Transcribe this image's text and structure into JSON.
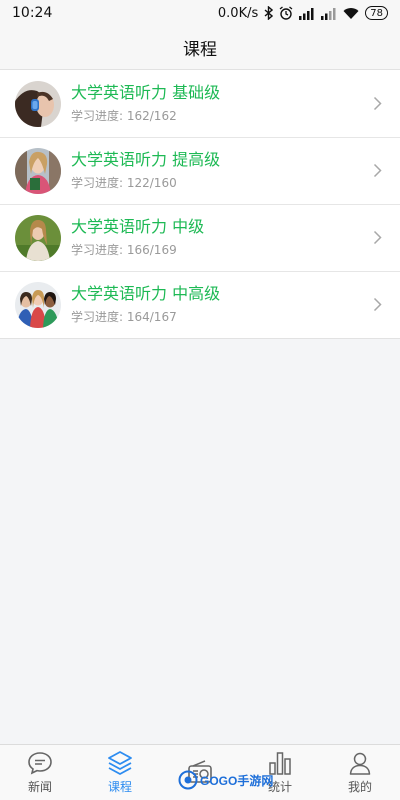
{
  "status_bar": {
    "time": "10:24",
    "network_speed": "0.0K/s",
    "battery": "78",
    "icons": [
      "bluetooth-icon",
      "alarm-icon",
      "signal-icon",
      "signal-icon",
      "wifi-icon",
      "battery-icon"
    ]
  },
  "header": {
    "title": "课程"
  },
  "courses": [
    {
      "title": "大学英语听力 基础级",
      "progress": "学习进度: 162/162"
    },
    {
      "title": "大学英语听力 提高级",
      "progress": "学习进度: 122/160"
    },
    {
      "title": "大学英语听力 中级",
      "progress": "学习进度: 166/169"
    },
    {
      "title": "大学英语听力 中高级",
      "progress": "学习进度: 164/167"
    }
  ],
  "tabs": [
    {
      "label": "新闻",
      "icon": "chat-bubble-icon",
      "active": false
    },
    {
      "label": "课程",
      "icon": "layers-icon",
      "active": true
    },
    {
      "label": "",
      "icon": "radio-icon",
      "active": false
    },
    {
      "label": "统计",
      "icon": "bar-chart-icon",
      "active": false
    },
    {
      "label": "我的",
      "icon": "user-icon",
      "active": false
    }
  ],
  "watermark": {
    "text": "GOGO手游网"
  },
  "colors": {
    "accent_green": "#1db954",
    "tab_active_blue": "#2d8cf0",
    "background": "#f4f5f7"
  }
}
